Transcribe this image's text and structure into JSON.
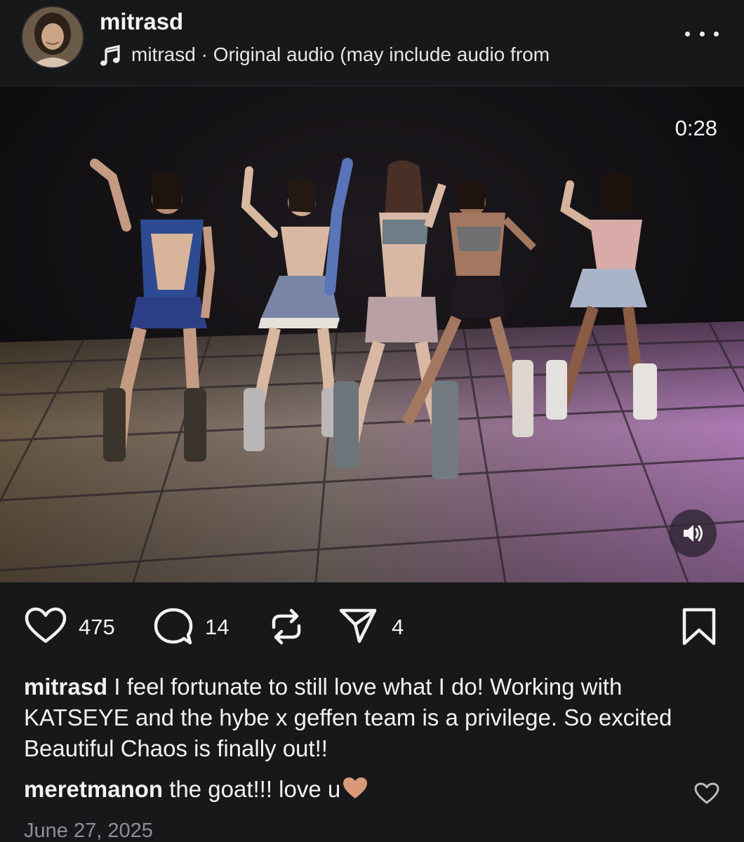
{
  "post": {
    "username": "mitrasd",
    "audio": {
      "owner": "mitrasd",
      "separator": " · ",
      "label": "Original audio  (may include audio from"
    },
    "video_time": "0:28"
  },
  "actions": {
    "likes": "475",
    "comments": "14",
    "shares": "4"
  },
  "caption": {
    "username": "mitrasd",
    "text": " I feel fortunate to still love what I do!  Working with KATSEYE and the hybe x geffen team is a privilege. So excited Beautiful Chaos is finally out!!"
  },
  "comment": {
    "username": "meretmanon",
    "text": " the goat!!! love u"
  },
  "date": "June 27, 2025",
  "colors": {
    "background": "#17181a",
    "emoji_heart": "#d99a7a"
  }
}
